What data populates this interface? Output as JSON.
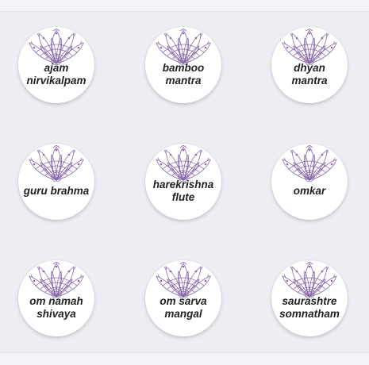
{
  "colors": {
    "background": "#eceef3",
    "tile": "#ffffff",
    "mandala": "#8a6aa8",
    "text": "#222222"
  },
  "tiles": [
    {
      "label": "ajam\nnirvikalpam",
      "icon": "mandala-icon"
    },
    {
      "label": "bamboo\nmantra",
      "icon": "mandala-icon"
    },
    {
      "label": "dhyan\nmantra",
      "icon": "mandala-icon"
    },
    {
      "label": "guru brahma",
      "icon": "mandala-icon"
    },
    {
      "label": "harekrishna\nflute",
      "icon": "mandala-icon"
    },
    {
      "label": "omkar",
      "icon": "mandala-icon"
    },
    {
      "label": "om namah\nshivaya",
      "icon": "mandala-icon"
    },
    {
      "label": "om sarva\nmangal",
      "icon": "mandala-icon"
    },
    {
      "label": "saurashtre\nsomnatham",
      "icon": "mandala-icon"
    }
  ]
}
